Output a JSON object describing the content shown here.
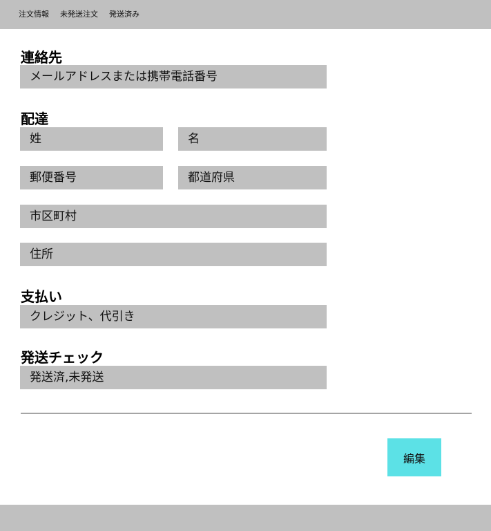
{
  "nav": {
    "items": [
      {
        "label": "注文情報"
      },
      {
        "label": "未発送注文"
      },
      {
        "label": "発送済み"
      }
    ]
  },
  "sections": {
    "contact": {
      "title": "連絡先",
      "field_placeholder": "メールアドレスまたは携帯電話番号"
    },
    "delivery": {
      "title": "配達",
      "last_name": "姓",
      "first_name": "名",
      "postal_code": "郵便番号",
      "prefecture": "都道府県",
      "city": "市区町村",
      "address": "住所"
    },
    "payment": {
      "title": "支払い",
      "field_value": "クレジット、代引き"
    },
    "shipping_check": {
      "title": "発送チェック",
      "field_value": "発送済,未発送"
    }
  },
  "actions": {
    "edit_label": "編集"
  },
  "colors": {
    "bar_gray": "#c0c0c0",
    "field_gray": "#c0c0c0",
    "edit_button": "#5ce1e6"
  }
}
